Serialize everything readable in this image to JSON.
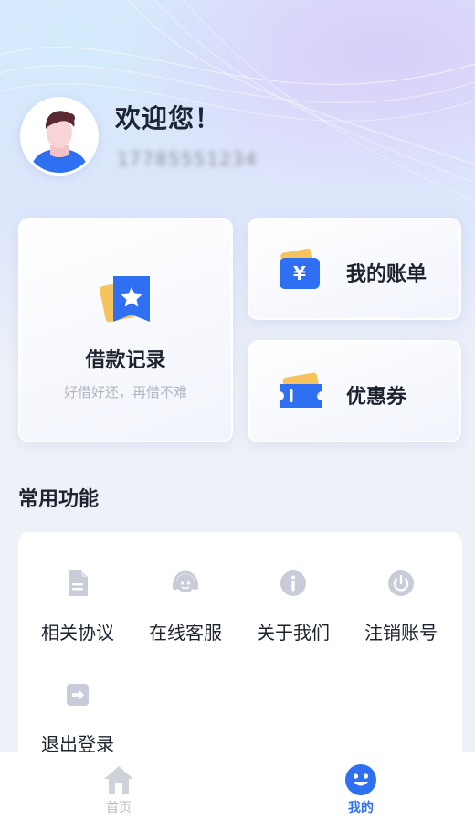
{
  "profile": {
    "welcome": "欢迎您！",
    "phone": "17785551234"
  },
  "cards": {
    "loan": {
      "title": "借款记录",
      "subtitle": "好借好还，再借不难"
    },
    "bill": {
      "title": "我的账单"
    },
    "coupon": {
      "title": "优惠券"
    }
  },
  "common": {
    "title": "常用功能",
    "items": [
      {
        "label": "相关协议",
        "icon": "document-icon"
      },
      {
        "label": "在线客服",
        "icon": "headset-icon"
      },
      {
        "label": "关于我们",
        "icon": "info-icon"
      },
      {
        "label": "注销账号",
        "icon": "power-icon"
      },
      {
        "label": "退出登录",
        "icon": "logout-icon"
      }
    ]
  },
  "tabs": [
    {
      "label": "首页",
      "icon": "home-icon",
      "active": false
    },
    {
      "label": "我的",
      "icon": "smile-icon",
      "active": true
    }
  ],
  "colors": {
    "accent": "#2f6ff2",
    "icon_gray": "#c7ccd8",
    "tab_inactive": "#b9bcc4",
    "card_orange": "#f7c35e"
  }
}
